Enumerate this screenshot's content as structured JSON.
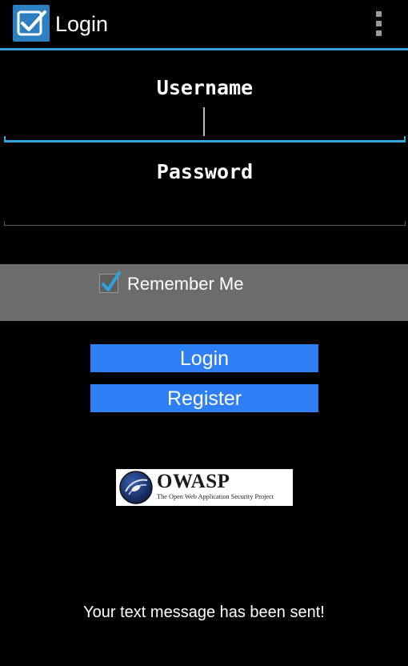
{
  "action_bar": {
    "title": "Login",
    "app_icon": "check-clipboard-icon",
    "overflow_icon": "more-vert-icon",
    "accent_color": "#33a3e0"
  },
  "form": {
    "username_hint": "Username",
    "username_value": "",
    "password_hint": "Password",
    "password_value": ""
  },
  "remember_me": {
    "label": "Remember Me",
    "checked": true
  },
  "buttons": {
    "login_label": "Login",
    "register_label": "Register",
    "color": "#2e7ff4"
  },
  "logo": {
    "wordmark": "OWASP",
    "tagline": "The Open Web Application Security Project"
  },
  "status_message": "Your text message has been sent!"
}
